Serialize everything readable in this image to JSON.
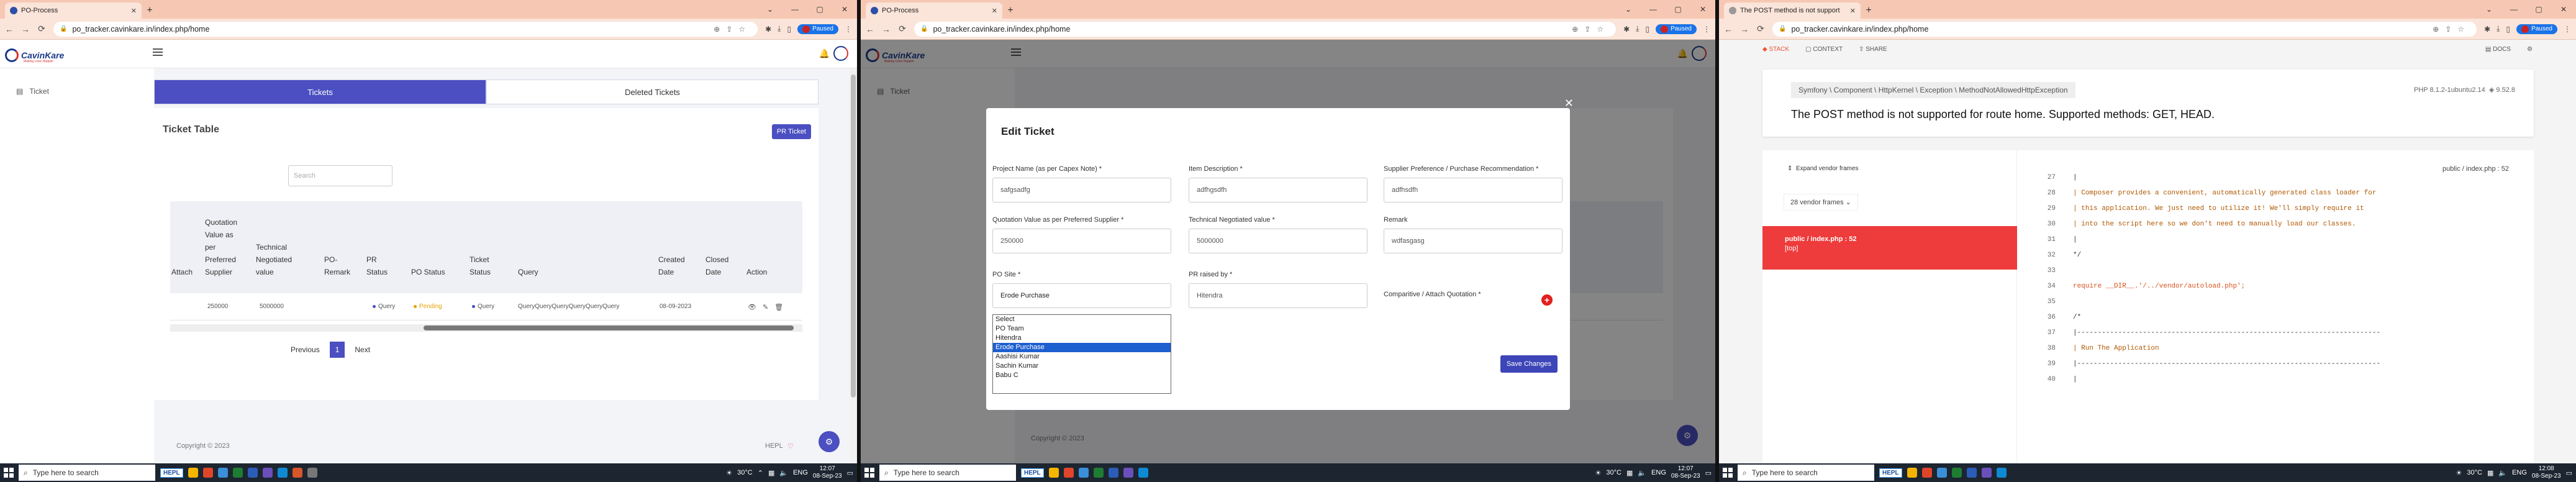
{
  "browser": {
    "tab1_title": "PO-Process",
    "tab3_title": "The POST method is not support",
    "url": "po_tracker.cavinkare.in/index.php/home",
    "paused_label": "Paused"
  },
  "taskbar": {
    "search_placeholder": "Type here to search",
    "hepl_label": "HEPL",
    "temp": "30°C",
    "lang": "ENG",
    "time": "12:07",
    "time3": "12:08",
    "date": "08-Sep-23"
  },
  "app": {
    "logo_name": "CavinKare",
    "logo_tagline": "Making Lives Happier",
    "sidebar_ticket": "Ticket",
    "tab_tickets": "Tickets",
    "tab_deleted": "Deleted Tickets",
    "table_title": "Ticket Table",
    "pr_ticket_button": "PR Ticket",
    "search_placeholder": "Search",
    "columns": [
      "Attach",
      "Quotation Value as per Preferred Supplier",
      "Technical Negotiated value",
      "PO-Remark",
      "PR Status",
      "PO Status",
      "Ticket Status",
      "Query",
      "Created Date",
      "Closed Date",
      "Action"
    ],
    "row": {
      "quotation": "250000",
      "technical": "5000000",
      "pr_status": "Query",
      "po_status": "Pending",
      "ticket_status": "Query",
      "query": "QueryQueryQueryQueryQueryQuery",
      "created": "08-09-2023"
    },
    "pager_prev": "Previous",
    "pager_page": "1",
    "pager_next": "Next",
    "copyright": "Copyright © 2023",
    "footer_right": "HEPL",
    "colors": {
      "primary": "#4b4fc1",
      "danger": "#e02020"
    }
  },
  "modal": {
    "title": "Edit Ticket",
    "project_label": "Project Name (as per Capex Note) *",
    "project_value": "safgsadfg",
    "item_label": "Item Description *",
    "item_value": "adfhgsdfh",
    "supplier_label": "Supplier Preference / Purchase Recommendation *",
    "supplier_value": "adfhsdfh",
    "quotation_label": "Quotation Value as per Preferred Supplier *",
    "quotation_value": "250000",
    "technical_label": "Technical Negotiated value *",
    "technical_value": "5000000",
    "remark_label": "Remark",
    "remark_value": "wdfasgasg",
    "po_site_label": "PO Site *",
    "po_site_value": "Erode Purchase",
    "pr_raised_label": "PR raised by *",
    "pr_raised_value": "Hitendra",
    "attach_label": "Comparitive / Attach Quotation *",
    "dropdown_options": [
      "Select",
      "PO Team",
      "Hitendra",
      "Erode Purchase",
      "Aashisi Kumar",
      "Sachin Kumar",
      "Babu C"
    ],
    "save_button": "Save Changes"
  },
  "error": {
    "stack_tab": "STACK",
    "context_tab": "CONTEXT",
    "share_tab": "SHARE",
    "docs": "DOCS",
    "exception_class": "Symfony \\ Component \\ HttpKernel \\ Exception \\ MethodNotAllowedHttpException",
    "message": "The POST method is not supported for route home. Supported methods: GET, HEAD.",
    "php_version": "PHP 8.1.2-1ubuntu2.14",
    "laravel_version": "9.52.8",
    "expand_frames": "Expand vendor frames",
    "vendor_frames": "28 vendor frames",
    "frame_file": "public / index.php : 52",
    "frame_tag": "[top]",
    "file_path": "public / index.php : 52",
    "code_lines": [
      {
        "n": "27",
        "t": "|",
        "k": ""
      },
      {
        "n": "28",
        "t": "| Composer provides a convenient, automatically generated class loader for",
        "k": "h"
      },
      {
        "n": "29",
        "t": "| this application. We just need to utilize it! We'll simply require it",
        "k": "h"
      },
      {
        "n": "30",
        "t": "| into the script here so we don't need to manually load our classes.",
        "k": "h"
      },
      {
        "n": "31",
        "t": "|",
        "k": ""
      },
      {
        "n": "32",
        "t": "*/",
        "k": ""
      },
      {
        "n": "33",
        "t": "",
        "k": ""
      },
      {
        "n": "34",
        "t": "require __DIR__.'/../vendor/autoload.php';",
        "k": "c"
      },
      {
        "n": "35",
        "t": "",
        "k": ""
      },
      {
        "n": "36",
        "t": "/*",
        "k": ""
      },
      {
        "n": "37",
        "t": "|--------------------------------------------------------------------------",
        "k": ""
      },
      {
        "n": "38",
        "t": "| Run The Application",
        "k": "h"
      },
      {
        "n": "39",
        "t": "|--------------------------------------------------------------------------",
        "k": ""
      },
      {
        "n": "40",
        "t": "|",
        "k": ""
      }
    ]
  }
}
